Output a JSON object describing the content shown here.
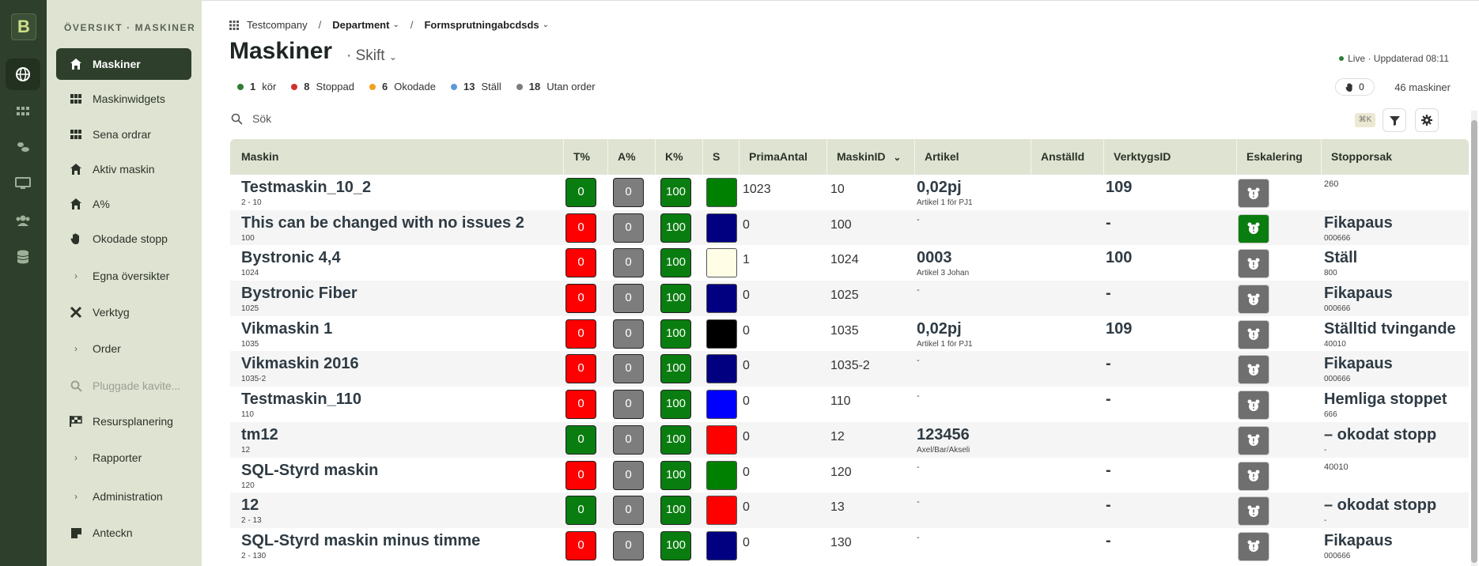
{
  "sidebar": {
    "heading": "ÖVERSIKT · MASKINER",
    "items": [
      {
        "label": "Maskiner",
        "icon": "home-icon"
      },
      {
        "label": "Maskinwidgets",
        "icon": "grid-icon"
      },
      {
        "label": "Sena ordrar",
        "icon": "grid-icon"
      },
      {
        "label": "Aktiv maskin",
        "icon": "home-icon"
      },
      {
        "label": "A%",
        "icon": "home-icon"
      },
      {
        "label": "Okodade stopp",
        "icon": "hand-icon"
      },
      {
        "label": "Egna översikter",
        "icon": "chevron-right-icon"
      },
      {
        "label": "Verktyg",
        "icon": "tools-icon"
      },
      {
        "label": "Order",
        "icon": "chevron-right-icon"
      },
      {
        "label": "Pluggade kavite...",
        "icon": "search-icon"
      },
      {
        "label": "Resursplanering",
        "icon": "flag-icon"
      },
      {
        "label": "Rapporter",
        "icon": "chevron-right-icon"
      },
      {
        "label": "Administration",
        "icon": "chevron-right-icon"
      },
      {
        "label": "Anteckn",
        "icon": "note-icon"
      }
    ]
  },
  "breadcrumb": {
    "company": "Testcompany",
    "sep": "/",
    "department": "Department",
    "group": "Formsprutningabcdsds"
  },
  "page": {
    "title": "Maskiner",
    "shift": "· Skift",
    "live": "Live · Uppdaterad 08:11",
    "hand_count": "0",
    "machine_count": "46 maskiner"
  },
  "stats": [
    {
      "n": "1",
      "label": "kör",
      "color": "#2e7d32"
    },
    {
      "n": "8",
      "label": "Stoppad",
      "color": "#d32f2f"
    },
    {
      "n": "6",
      "label": "Okodade",
      "color": "#f0a020"
    },
    {
      "n": "13",
      "label": "Ställ",
      "color": "#5b9bd5"
    },
    {
      "n": "18",
      "label": "Utan order",
      "color": "#7a7f7a"
    }
  ],
  "search": {
    "placeholder": "Sök",
    "shortcut": "⌘K"
  },
  "table": {
    "headers": {
      "maskin": "Maskin",
      "t": "T%",
      "a": "A%",
      "k": "K%",
      "s": "S",
      "prima": "PrimaAntal",
      "id": "MaskinID",
      "artikel": "Artikel",
      "anstalld": "Anställd",
      "verktyg": "VerktygsID",
      "eskalering": "Eskalering",
      "stopp": "Stopporsak"
    },
    "rows": [
      {
        "name": "Testmaskin_10_2",
        "sub": "2 - 10",
        "t": "0",
        "tc": "g",
        "a": "0",
        "k": "100",
        "s": "#008000",
        "prima": "1023",
        "id": "10",
        "art": "0,02pj",
        "artsub": "Artikel 1 för PJ1",
        "verktyg": "109",
        "esk": "gray",
        "stopp": "",
        "stoppsub": "260"
      },
      {
        "name": "This can be changed with no issues 2",
        "sub": "100",
        "t": "0",
        "tc": "r",
        "a": "0",
        "k": "100",
        "s": "#000080",
        "prima": "0",
        "id": "100",
        "art": "",
        "artsub": "-",
        "verktyg": "-",
        "esk": "green",
        "stopp": "Fikapaus",
        "stoppsub": "000666"
      },
      {
        "name": "Bystronic 4,4",
        "sub": "1024",
        "t": "0",
        "tc": "r",
        "a": "0",
        "k": "100",
        "s": "#fffde6",
        "prima": "1",
        "id": "1024",
        "art": "0003",
        "artsub": "Artikel 3 Johan",
        "verktyg": "100",
        "esk": "gray",
        "stopp": "Ställ",
        "stoppsub": "800"
      },
      {
        "name": "Bystronic Fiber",
        "sub": "1025",
        "t": "0",
        "tc": "r",
        "a": "0",
        "k": "100",
        "s": "#000080",
        "prima": "0",
        "id": "1025",
        "art": "",
        "artsub": "-",
        "verktyg": "-",
        "esk": "gray",
        "stopp": "Fikapaus",
        "stoppsub": "000666"
      },
      {
        "name": "Vikmaskin 1",
        "sub": "1035",
        "t": "0",
        "tc": "r",
        "a": "0",
        "k": "100",
        "s": "#000000",
        "prima": "0",
        "id": "1035",
        "art": "0,02pj",
        "artsub": "Artikel 1 för PJ1",
        "verktyg": "109",
        "esk": "gray",
        "stopp": "Ställtid tvingande",
        "stoppsub": "40010"
      },
      {
        "name": "Vikmaskin 2016",
        "sub": "1035-2",
        "t": "0",
        "tc": "r",
        "a": "0",
        "k": "100",
        "s": "#000080",
        "prima": "0",
        "id": "1035-2",
        "art": "",
        "artsub": "-",
        "verktyg": "-",
        "esk": "gray",
        "stopp": "Fikapaus",
        "stoppsub": "000666"
      },
      {
        "name": "Testmaskin_110",
        "sub": "110",
        "t": "0",
        "tc": "r",
        "a": "0",
        "k": "100",
        "s": "#0000ff",
        "prima": "0",
        "id": "110",
        "art": "",
        "artsub": "-",
        "verktyg": "-",
        "esk": "gray",
        "stopp": "Hemliga stoppet",
        "stoppsub": "666"
      },
      {
        "name": "tm12",
        "sub": "12",
        "t": "0",
        "tc": "g",
        "a": "0",
        "k": "100",
        "s": "#ff0000",
        "prima": "0",
        "id": "12",
        "art": "123456",
        "artsub": "Axel/Bar/Akseli",
        "verktyg": "",
        "esk": "gray",
        "stopp": "– okodat stopp",
        "stoppsub": "-"
      },
      {
        "name": "SQL-Styrd maskin",
        "sub": "120",
        "t": "0",
        "tc": "r",
        "a": "0",
        "k": "100",
        "s": "#008000",
        "prima": "0",
        "id": "120",
        "art": "",
        "artsub": "-",
        "verktyg": "-",
        "esk": "gray",
        "stopp": "",
        "stoppsub": "40010"
      },
      {
        "name": "12",
        "sub": "2 - 13",
        "t": "0",
        "tc": "g",
        "a": "0",
        "k": "100",
        "s": "#ff0000",
        "prima": "0",
        "id": "13",
        "art": "",
        "artsub": "-",
        "verktyg": "-",
        "esk": "gray",
        "stopp": "– okodat stopp",
        "stoppsub": "-"
      },
      {
        "name": "SQL-Styrd maskin minus timme",
        "sub": "2 - 130",
        "t": "0",
        "tc": "r",
        "a": "0",
        "k": "100",
        "s": "#000080",
        "prima": "0",
        "id": "130",
        "art": "",
        "artsub": "-",
        "verktyg": "-",
        "esk": "gray",
        "stopp": "Fikapaus",
        "stoppsub": "000666"
      }
    ]
  }
}
